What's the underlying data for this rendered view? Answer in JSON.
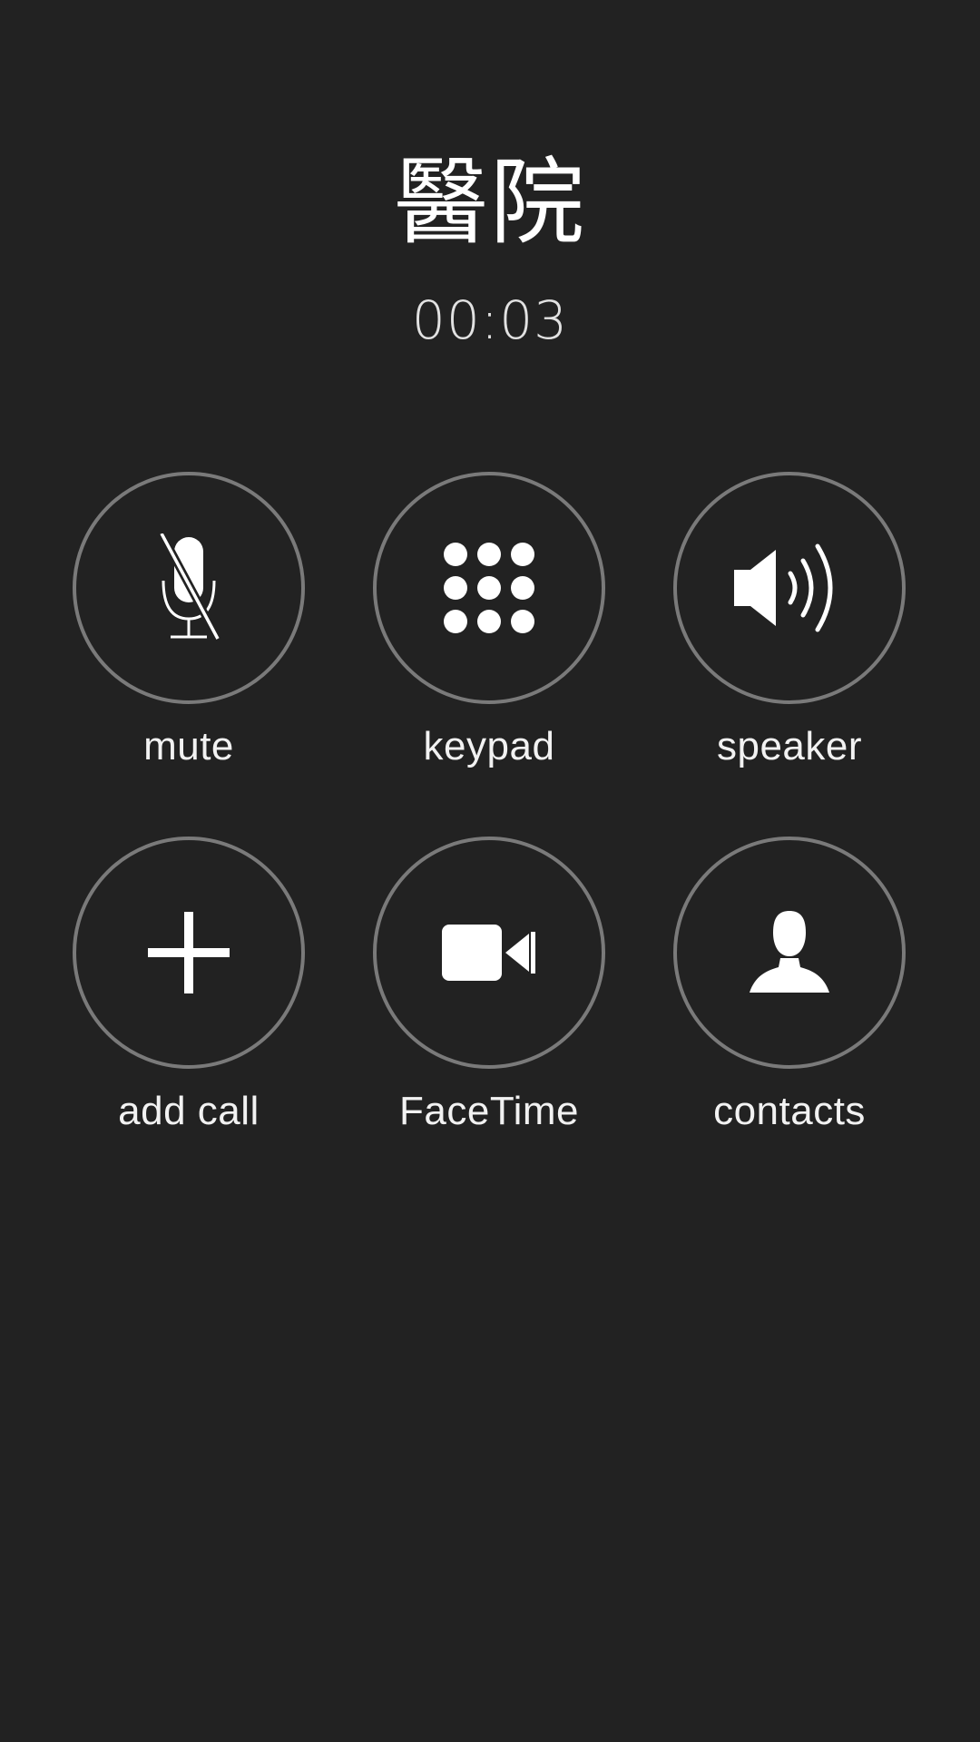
{
  "call": {
    "name": "醫院",
    "timer": "00:03"
  },
  "controls": [
    {
      "id": "mute",
      "label": "mute",
      "icon": "mic-slash-icon"
    },
    {
      "id": "keypad",
      "label": "keypad",
      "icon": "keypad-grid-icon"
    },
    {
      "id": "speaker",
      "label": "speaker",
      "icon": "speaker-icon"
    },
    {
      "id": "add-call",
      "label": "add call",
      "icon": "plus-icon"
    },
    {
      "id": "facetime",
      "label": "FaceTime",
      "icon": "video-camera-icon"
    },
    {
      "id": "contacts",
      "label": "contacts",
      "icon": "person-icon"
    }
  ],
  "colors": {
    "background": "#222222",
    "circle_border": "#7a7a7a",
    "icon": "#ffffff",
    "label": "#f2f2f2"
  }
}
